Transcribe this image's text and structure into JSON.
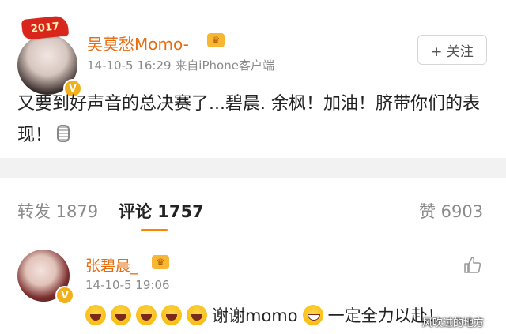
{
  "post": {
    "avatar_badge_text": "2017",
    "username": "吴莫愁Momo-",
    "verified_badge": "V",
    "meta": "14-10-5 16:29  来自iPhone客户端",
    "follow_button": {
      "icon": "plus-icon",
      "label": "+ 关注"
    },
    "content": "又要到好声音的总决赛了...碧晨. 余枫！加油！脐带你们的表现！"
  },
  "tabs": {
    "repost": "转发 1879",
    "comment": "评论 1757",
    "like": "赞 6903",
    "accent_color": "#ff8200"
  },
  "comment": {
    "username": "张碧晨_",
    "verified_badge": "V",
    "meta": "14-10-5 19:06",
    "text_a": "谢谢momo",
    "text_b": "一定全力以赴！",
    "like_icon": "thumbs-up-icon"
  },
  "watermark": "风吹过的地方",
  "colors": {
    "username": "#e86b0e",
    "divider": "#f2f2f2",
    "meta": "#8a8a8a"
  }
}
